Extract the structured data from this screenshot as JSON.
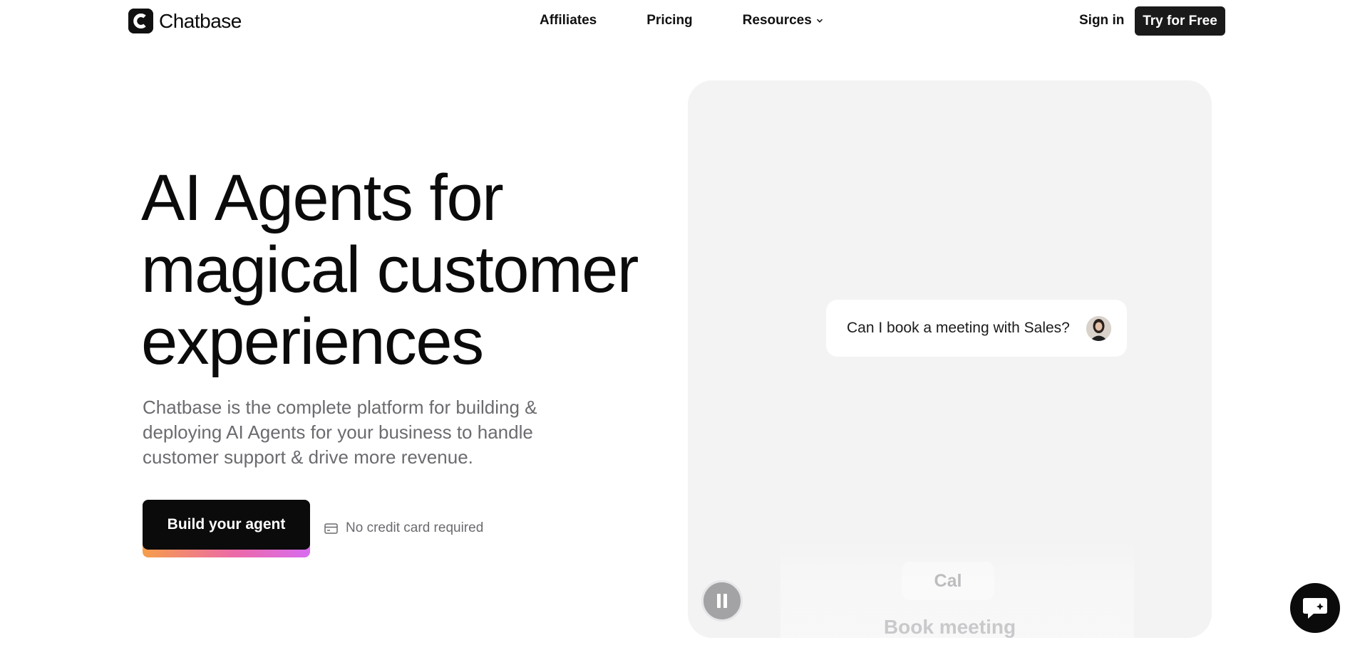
{
  "nav": {
    "brand": "Chatbase",
    "links": [
      "Affiliates",
      "Pricing",
      "Resources"
    ],
    "sign_in": "Sign in",
    "cta": "Try for Free"
  },
  "hero": {
    "title_lines": [
      "AI Agents for",
      "magical customer",
      "experiences"
    ],
    "subtitle_lines": [
      "Chatbase is the complete platform for building &",
      "deploying AI Agents for your business to handle",
      "customer support & drive more revenue."
    ],
    "cta": "Build your agent",
    "note": "No credit card required"
  },
  "demo": {
    "message": "Can I book a meeting with Sales?",
    "chip": "Cal",
    "action": "Book meeting"
  },
  "colors": {
    "accent": "#0b0b0c",
    "gradient": [
      "#f59e4a",
      "#ec6aa8",
      "#d86cf0"
    ],
    "panel_bg": "#f3f3f4"
  }
}
